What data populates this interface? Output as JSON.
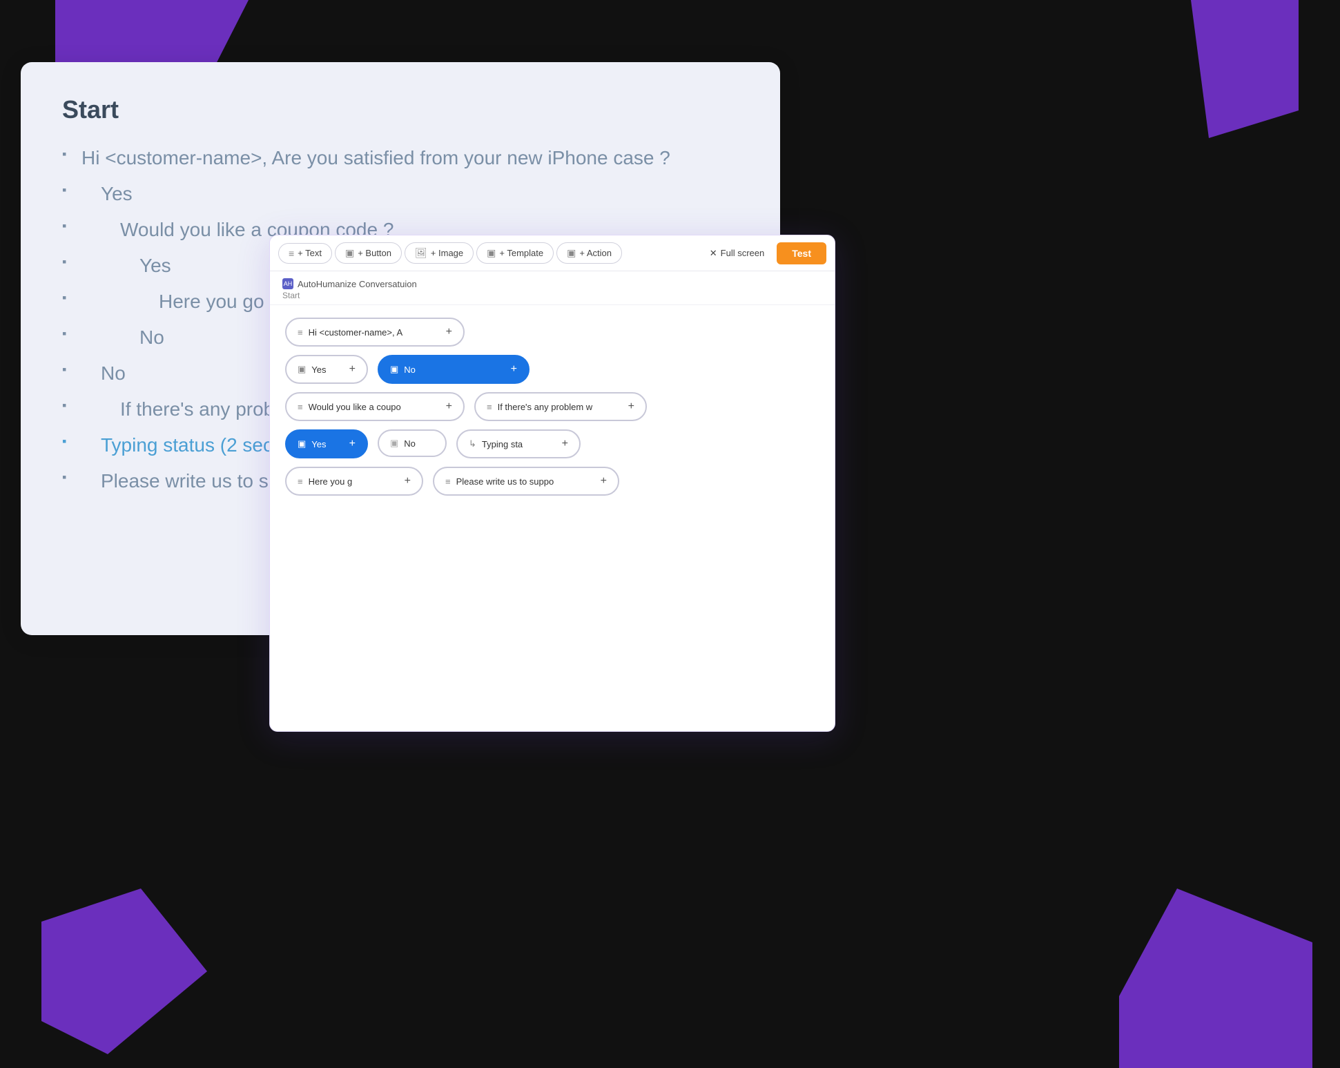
{
  "shapes": {
    "colors": {
      "purple": "#6b2fbd",
      "bg": "#111"
    }
  },
  "bg_card": {
    "title": "Start",
    "tree": [
      {
        "level": 0,
        "text": "Hi <customer-name>, Are you satisfied from your new iPhone case ?",
        "highlight": false
      },
      {
        "level": 1,
        "text": "Yes",
        "highlight": false
      },
      {
        "level": 2,
        "text": "Would you like a coupon code ?",
        "highlight": false
      },
      {
        "level": 3,
        "text": "Yes",
        "highlight": false
      },
      {
        "level": 4,
        "text": "Here you go <Co",
        "highlight": false
      },
      {
        "level": 3,
        "text": "No",
        "highlight": false
      },
      {
        "level": 1,
        "text": "No",
        "highlight": false
      },
      {
        "level": 2,
        "text": "If there's any proble",
        "highlight": false
      },
      {
        "level": 0,
        "text": "Typing status (2 sec",
        "highlight": true
      },
      {
        "level": 0,
        "text": "Please write us to si",
        "highlight": false
      }
    ]
  },
  "toolbar": {
    "buttons": [
      {
        "id": "text-btn",
        "icon": "≡",
        "label": "+ Text"
      },
      {
        "id": "button-btn",
        "icon": "▣",
        "label": "+ Button"
      },
      {
        "id": "image-btn",
        "icon": "🖼",
        "label": "+ Image"
      },
      {
        "id": "template-btn",
        "icon": "▣",
        "label": "+ Template"
      },
      {
        "id": "action-btn",
        "icon": "▣",
        "label": "+ Action"
      }
    ],
    "fullscreen_label": "Full screen",
    "test_label": "Test"
  },
  "panel_header": {
    "icon_label": "AH",
    "title": "AutoHumanize Conversatuion",
    "start_label": "Start"
  },
  "flow": {
    "rows": [
      {
        "id": "row1",
        "nodes": [
          {
            "id": "msg1",
            "icon": "≡",
            "text": "Hi <customer-name>, A",
            "active": false,
            "plus": true,
            "colspan": 2
          }
        ]
      },
      {
        "id": "row2",
        "nodes": [
          {
            "id": "yes1",
            "icon": "▣",
            "text": "Yes",
            "active": false,
            "plus": true,
            "type": "yes"
          },
          {
            "id": "no1",
            "icon": "▣",
            "text": "No",
            "active": true,
            "plus": true,
            "type": "no-active"
          }
        ]
      },
      {
        "id": "row3",
        "nodes": [
          {
            "id": "coupon",
            "icon": "≡",
            "text": "Would you like a coupo",
            "active": false,
            "plus": true
          },
          {
            "id": "ifproblem",
            "icon": "≡",
            "text": "If there's any problem w",
            "active": false,
            "plus": true
          }
        ]
      },
      {
        "id": "row4",
        "nodes": [
          {
            "id": "yes2",
            "icon": "▣",
            "text": "Yes",
            "active": true,
            "plus": true,
            "type": "yes-active"
          },
          {
            "id": "no2",
            "icon": "▣",
            "text": "No",
            "active": false,
            "type": "no"
          },
          {
            "id": "typing",
            "icon": "↳",
            "text": "Typing sta",
            "active": false,
            "plus": true,
            "type": "typing"
          }
        ]
      },
      {
        "id": "row5",
        "nodes": [
          {
            "id": "hereyou",
            "icon": "≡",
            "text": "Here you g",
            "active": false,
            "plus": true
          },
          {
            "id": "please",
            "icon": "≡",
            "text": "Please write us to suppo",
            "active": false,
            "plus": true
          }
        ]
      }
    ]
  }
}
